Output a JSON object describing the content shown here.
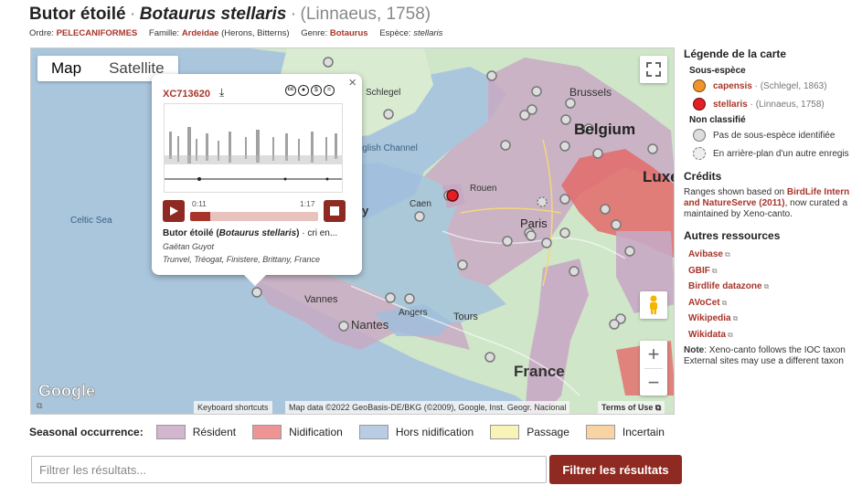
{
  "header": {
    "common_name": "Butor étoilé",
    "sep1": "·",
    "sci_name": "Botaurus stellaris",
    "sep2": "·",
    "authority": "(Linnaeus, 1758)"
  },
  "taxonomy": {
    "order_label": "Ordre:",
    "order": "PELECANIFORMES",
    "family_label": "Famille:",
    "family": "Ardeidae",
    "family_common": "(Herons, Bitterns)",
    "genus_label": "Genre:",
    "genus": "Botaurus",
    "species_label": "Espèce:",
    "species": "stellaris"
  },
  "map": {
    "tabs": [
      "Map",
      "Satellite"
    ],
    "active_tab": "Map",
    "labels": {
      "celtic_sea": "Celtic Sea",
      "channel": "English Channel",
      "brussels": "Brussels",
      "belgium": "Belgium",
      "lux": "Luxe",
      "rouen": "Rouen",
      "caen": "Caen",
      "paris": "Paris",
      "vannes": "Vannes",
      "nantes": "Nantes",
      "angers": "Angers",
      "tours": "Tours",
      "france": "France",
      "schlegel": "Schlegel",
      "y": "y"
    },
    "google_logo": "Google",
    "attribution": {
      "shortcuts": "Keyboard shortcuts",
      "data": "Map data ©2022 GeoBasis-DE/BKG (©2009), Google, Inst. Geogr. Nacional",
      "terms": "Terms of Use"
    },
    "zoom_in": "+",
    "zoom_out": "−",
    "colors": {
      "resident": "#c8a9c4",
      "breeding": "#e46a6a",
      "nonbreeding": "#9fbedc",
      "passage": "#f8f0a8",
      "uncertain": "#f7c98a",
      "sea": "#aac6dd",
      "land": "#cfe6c9"
    }
  },
  "popup": {
    "recording_id": "XC713620",
    "time_current": "0:11",
    "time_total": "1:17",
    "progress": 0.16,
    "title_common": "Butor étoilé",
    "title_sci": "Botaurus stellaris",
    "title_rest": "· cri en...",
    "recordist": "Gaëtan Guyot",
    "location": "Trunvel, Tréogat, Finistere, Brittany, France",
    "close": "×"
  },
  "legend": {
    "title": "Légende de la carte",
    "subspecies_heading": "Sous-espèce",
    "subspecies": [
      {
        "name": "capensis",
        "author": "· (Schlegel, 1863)",
        "color": "#f0952e"
      },
      {
        "name": "stellaris",
        "author": "· (Linnaeus, 1758)",
        "color": "#e31e26"
      }
    ],
    "unclassified_heading": "Non classifié",
    "unclassified": [
      {
        "text": "Pas de sous-espèce identifiée"
      },
      {
        "text": "En arrière-plan d'un autre enregis"
      }
    ],
    "credits_title": "Crédits",
    "credits_pre": "Ranges shown based on ",
    "credits_link": "BirdLife Intern and NatureServe (2011)",
    "credits_post": ", now curated a maintained by Xeno-canto.",
    "resources_title": "Autres ressources",
    "resources": [
      "Avibase",
      "GBIF",
      "Birdlife datazone",
      "AVoCet",
      "Wikipedia",
      "Wikidata"
    ],
    "note_label": "Note",
    "note_text": ": Xeno-canto follows the IOC taxon External sites may use a different taxon"
  },
  "seasonal": {
    "label": "Seasonal occurrence:",
    "items": [
      {
        "name": "Résident",
        "color": "#d2b6cf"
      },
      {
        "name": "Nidification",
        "color": "#ef9494"
      },
      {
        "name": "Hors nidification",
        "color": "#b8cde3"
      },
      {
        "name": "Passage",
        "color": "#f9f3b8"
      },
      {
        "name": "Incertain",
        "color": "#f8d3a3"
      }
    ]
  },
  "filter": {
    "placeholder": "Filtrer les résultats...",
    "button": "Filtrer les résultats"
  }
}
